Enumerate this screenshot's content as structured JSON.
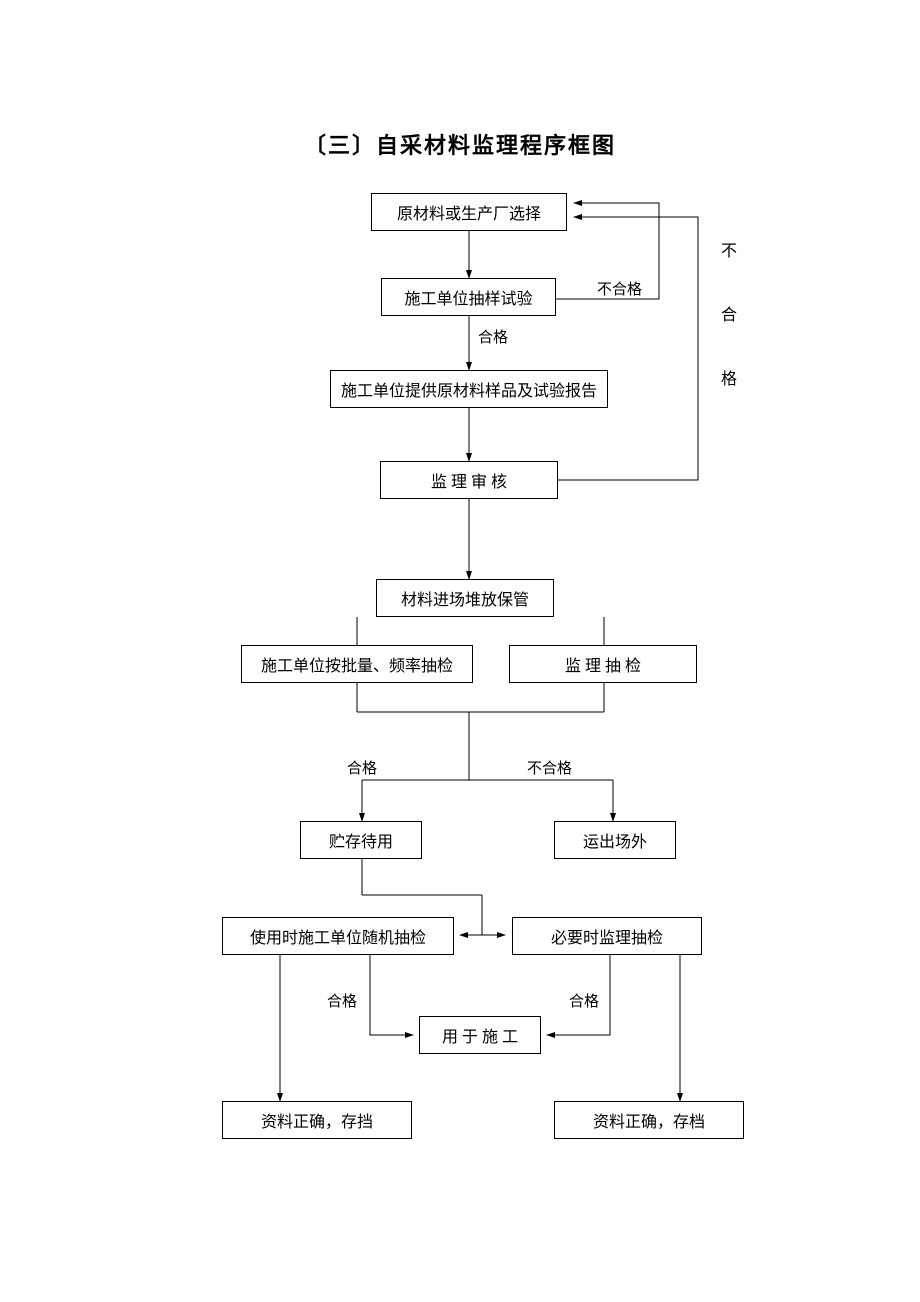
{
  "title": "〔三〕自采材料监理程序框图",
  "nodes": {
    "n1": "原材料或生产厂选择",
    "n2": "施工单位抽样试验",
    "n3": "施工单位提供原材料样品及试验报告",
    "n4": "监 理 审 核",
    "n5": "材料进场堆放保管",
    "n6": "施工单位按批量、频率抽检",
    "n7": "监 理 抽 检",
    "n8": "贮存待用",
    "n9": "运出场外",
    "n10": "使用时施工单位随机抽检",
    "n11": "必要时监理抽检",
    "n12": "用 于 施 工",
    "n13": "资料正确，存挡",
    "n14": "资料正确，存档"
  },
  "labels": {
    "l1": "不合格",
    "l2": "合格",
    "l3": "合格",
    "l4": "不合格",
    "l5": "合格",
    "l6": "合格",
    "sideFail": "不 合 格"
  },
  "chart_data": {
    "type": "flowchart",
    "title": "〔三〕自采材料监理程序框图",
    "nodes": [
      {
        "id": "n1",
        "label": "原材料或生产厂选择"
      },
      {
        "id": "n2",
        "label": "施工单位抽样试验"
      },
      {
        "id": "n3",
        "label": "施工单位提供原材料样品及试验报告"
      },
      {
        "id": "n4",
        "label": "监理审核"
      },
      {
        "id": "n5",
        "label": "材料进场堆放保管"
      },
      {
        "id": "n6",
        "label": "施工单位按批量、频率抽检"
      },
      {
        "id": "n7",
        "label": "监理抽检"
      },
      {
        "id": "n8",
        "label": "贮存待用"
      },
      {
        "id": "n9",
        "label": "运出场外"
      },
      {
        "id": "n10",
        "label": "使用时施工单位随机抽检"
      },
      {
        "id": "n11",
        "label": "必要时监理抽检"
      },
      {
        "id": "n12",
        "label": "用于施工"
      },
      {
        "id": "n13",
        "label": "资料正确，存挡"
      },
      {
        "id": "n14",
        "label": "资料正确，存档"
      }
    ],
    "edges": [
      {
        "from": "n1",
        "to": "n2"
      },
      {
        "from": "n2",
        "to": "n1",
        "label": "不合格"
      },
      {
        "from": "n2",
        "to": "n3",
        "label": "合格"
      },
      {
        "from": "n3",
        "to": "n4"
      },
      {
        "from": "n4",
        "to": "n1",
        "label": "不合格"
      },
      {
        "from": "n4",
        "to": "n5"
      },
      {
        "from": "n5",
        "to": "n6"
      },
      {
        "from": "n5",
        "to": "n7"
      },
      {
        "from": "n6",
        "to": "merge1"
      },
      {
        "from": "n7",
        "to": "merge1"
      },
      {
        "from": "merge1",
        "to": "n8",
        "label": "合格"
      },
      {
        "from": "merge1",
        "to": "n9",
        "label": "不合格"
      },
      {
        "from": "n8",
        "to": "n10"
      },
      {
        "from": "n8",
        "to": "n11"
      },
      {
        "from": "n10",
        "to": "n12",
        "label": "合格"
      },
      {
        "from": "n11",
        "to": "n12",
        "label": "合格"
      },
      {
        "from": "n10",
        "to": "n13"
      },
      {
        "from": "n11",
        "to": "n14"
      }
    ]
  }
}
